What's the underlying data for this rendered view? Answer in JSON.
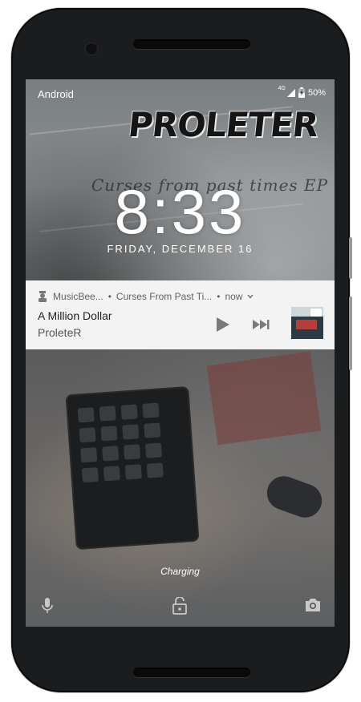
{
  "status_bar": {
    "carrier": "Android",
    "network": "4G",
    "battery_percent": "50%"
  },
  "wallpaper": {
    "logo_text": "PROLETER",
    "subtitle": "Curses from past times EP"
  },
  "lockscreen": {
    "time": "8:33",
    "date": "FRIDAY, DECEMBER 16",
    "charging_text": "Charging"
  },
  "notification": {
    "app_name": "MusicBee...",
    "separator": "•",
    "album": "Curses From Past Ti...",
    "time": "now",
    "title": "A Million Dollar",
    "artist": "ProleteR"
  },
  "colors": {
    "notification_bg": "#f3f3f3",
    "text_white": "#ffffff",
    "control_gray": "#7a7a7a"
  },
  "icons": [
    "signal-icon",
    "battery-icon",
    "app-icon",
    "play-icon",
    "skip-next-icon",
    "microphone-icon",
    "unlock-icon",
    "camera-icon"
  ]
}
